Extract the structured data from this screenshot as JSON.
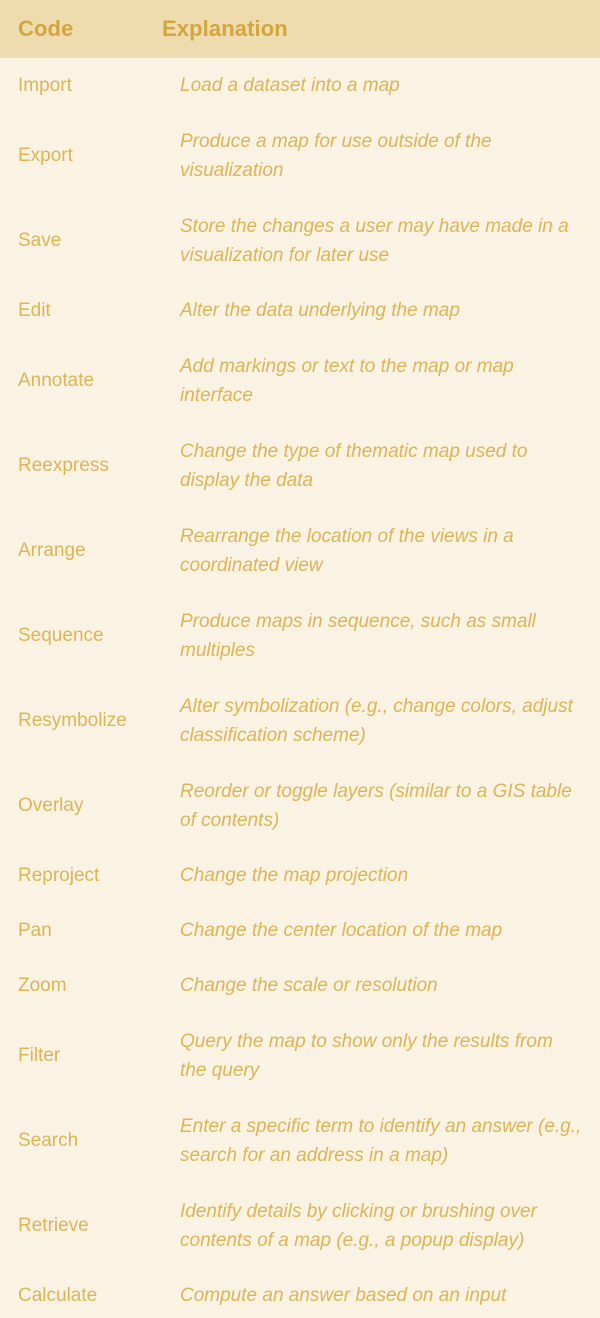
{
  "table": {
    "headers": {
      "code": "Code",
      "explanation": "Explanation"
    },
    "colors": {
      "header_background": "#eedcaf",
      "body_background": "#faf3e3",
      "header_text": "#d2a63c",
      "body_text": "#ddb456"
    },
    "rows": [
      {
        "code": "Import",
        "explanation": "Load a dataset into a map"
      },
      {
        "code": "Export",
        "explanation": "Produce a map for use outside of the visualization"
      },
      {
        "code": "Save",
        "explanation": "Store the changes a user may have made in a visualization for later use"
      },
      {
        "code": "Edit",
        "explanation": "Alter the data underlying the map"
      },
      {
        "code": "Annotate",
        "explanation": "Add markings or text to the map or map interface"
      },
      {
        "code": "Reexpress",
        "explanation": "Change the type of thematic map used to display the data"
      },
      {
        "code": "Arrange",
        "explanation": "Rearrange the location of the views in a coordinated view"
      },
      {
        "code": "Sequence",
        "explanation": "Produce maps in sequence, such as small multiples"
      },
      {
        "code": "Resymbolize",
        "explanation": "Alter symbolization (e.g., change colors, adjust classification scheme)"
      },
      {
        "code": "Overlay",
        "explanation": "Reorder or toggle layers (similar to a GIS table of contents)"
      },
      {
        "code": "Reproject",
        "explanation": "Change the map projection"
      },
      {
        "code": "Pan",
        "explanation": "Change the center location of the map"
      },
      {
        "code": "Zoom",
        "explanation": "Change the scale or resolution"
      },
      {
        "code": "Filter",
        "explanation": "Query the map to show only the results from the query"
      },
      {
        "code": "Search",
        "explanation": "Enter a specific term to identify an answer (e.g., search for an address in a map)"
      },
      {
        "code": "Retrieve",
        "explanation": "Identify details by clicking or brushing over contents of a map (e.g., a popup display)"
      },
      {
        "code": "Calculate",
        "explanation": "Compute an answer based on an input"
      }
    ]
  }
}
